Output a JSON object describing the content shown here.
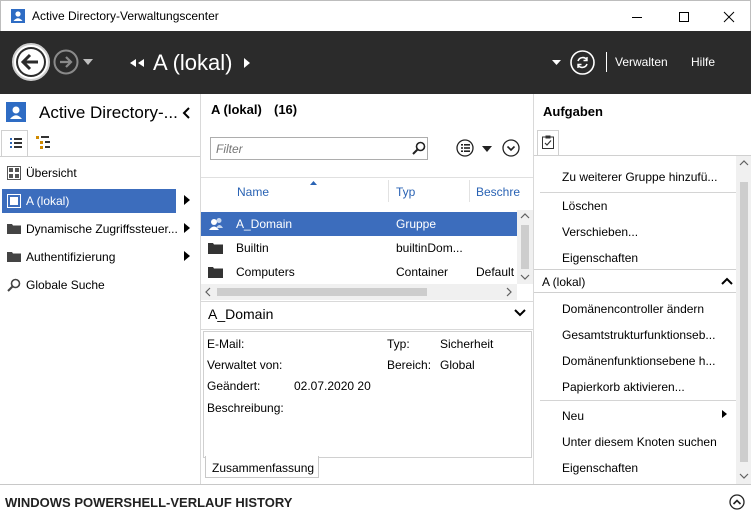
{
  "window": {
    "title": "Active Directory-Verwaltungscenter"
  },
  "navbar": {
    "location": "A (lokal)",
    "menu_manage": "Verwalten",
    "menu_help": "Hilfe"
  },
  "left": {
    "title": "Active Directory-...",
    "items": [
      {
        "label": "Übersicht"
      },
      {
        "label": "A (lokal)"
      },
      {
        "label": "Dynamische Zugriffssteuer..."
      },
      {
        "label": "Authentifizierung"
      },
      {
        "label": "Globale Suche"
      }
    ]
  },
  "middle": {
    "header_title": "A (lokal)",
    "header_count": "(16)",
    "filter_placeholder": "Filter",
    "columns": {
      "name": "Name",
      "type": "Typ",
      "desc": "Beschre"
    },
    "rows": [
      {
        "name": "A_Domain",
        "type": "Gruppe",
        "desc": ""
      },
      {
        "name": "Builtin",
        "type": "builtinDom...",
        "desc": ""
      },
      {
        "name": "Computers",
        "type": "Container",
        "desc": "Default"
      }
    ],
    "details": {
      "title": "A_Domain",
      "email_label": "E-Mail:",
      "managed_label": "Verwaltet von:",
      "changed_label": "Geändert:",
      "changed_value": "02.07.2020 20",
      "desc_label": "Beschreibung:",
      "type_label": "Typ:",
      "type_value": "Sicherheit",
      "scope_label": "Bereich:",
      "scope_value": "Global",
      "tab_label": "Zusammenfassung"
    }
  },
  "right": {
    "title": "Aufgaben",
    "group1": [
      {
        "label": "Zu weiterer Gruppe hinzufü..."
      },
      {
        "label": "Löschen"
      },
      {
        "label": "Verschieben..."
      },
      {
        "label": "Eigenschaften"
      }
    ],
    "section2_title": "A (lokal)",
    "group2": [
      {
        "label": "Domänencontroller ändern"
      },
      {
        "label": "Gesamtstrukturfunktionseb..."
      },
      {
        "label": "Domänenfunktionsebene h..."
      },
      {
        "label": "Papierkorb aktivieren..."
      }
    ],
    "group3": [
      {
        "label": "Neu"
      },
      {
        "label": "Unter diesem Knoten suchen"
      },
      {
        "label": "Eigenschaften"
      }
    ]
  },
  "bottom": {
    "label": "WINDOWS POWERSHELL-VERLAUF HISTORY"
  },
  "colors": {
    "accent": "#3c6dbd",
    "navbar_bg": "#2b2b2b",
    "column_header": "#2a63b4"
  }
}
